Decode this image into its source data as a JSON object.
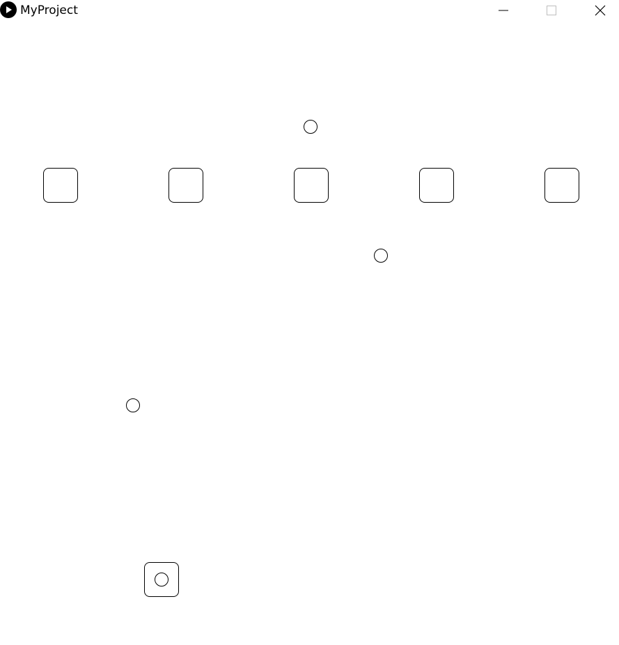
{
  "window": {
    "title": "MyProject",
    "app_icon": "play-circle-icon",
    "controls": {
      "minimize_icon": "minimize-icon",
      "maximize_icon": "maximize-icon",
      "close_icon": "close-icon"
    }
  },
  "scene": {
    "top_row_slots": 5,
    "paddle_slots": 1,
    "balls": 4,
    "stroke_color": "#000000",
    "background_color": "#ffffff"
  }
}
